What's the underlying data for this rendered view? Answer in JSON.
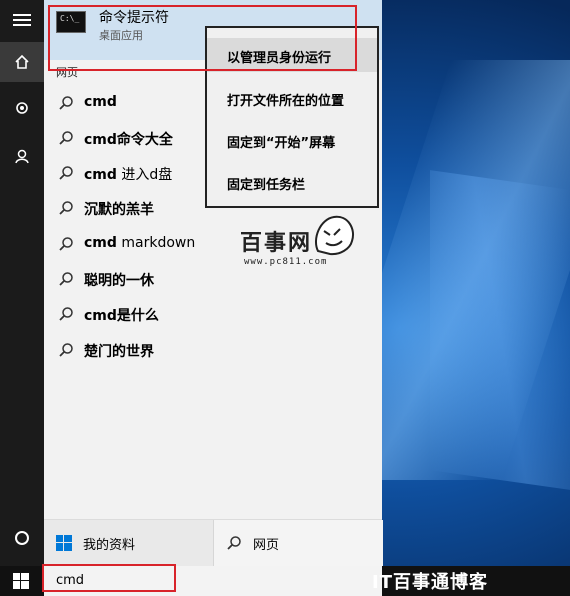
{
  "best_match": {
    "title": "命令提示符",
    "subtitle": "桌面应用"
  },
  "section_label": "网页",
  "results": [
    {
      "bold": "cmd",
      "rest": ""
    },
    {
      "bold": "cmd命令大全",
      "rest": ""
    },
    {
      "bold": "cmd",
      "rest": " 进入d盘"
    },
    {
      "bold": "沉默的羔羊",
      "rest": ""
    },
    {
      "bold": "cmd",
      "rest": " markdown"
    },
    {
      "bold": "聪明的一休",
      "rest": ""
    },
    {
      "bold": "cmd是什么",
      "rest": ""
    },
    {
      "bold": "楚门的世界",
      "rest": ""
    }
  ],
  "context_menu": [
    "以管理员身份运行",
    "打开文件所在的位置",
    "固定到“开始”屏幕",
    "固定到任务栏"
  ],
  "tabs": {
    "my_stuff": "我的资料",
    "web": "网页"
  },
  "search": {
    "value": "cmd"
  },
  "watermark": {
    "brand": "百事网",
    "url": "www.pc811.com",
    "corner": "IT百事通博客"
  },
  "colors": {
    "highlight": "#cfe1f1",
    "annotation_red": "#d8232a",
    "taskbar": "#111111"
  }
}
